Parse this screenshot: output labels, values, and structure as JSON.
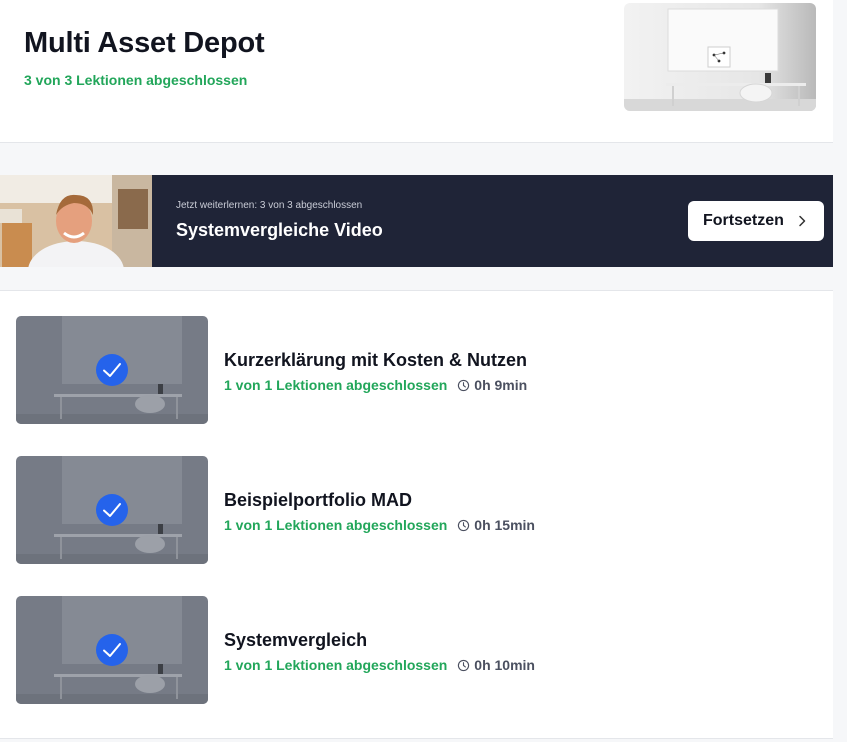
{
  "course": {
    "title": "Multi Asset Depot",
    "progress": "3 von 3 Lektionen abgeschlossen"
  },
  "continue": {
    "subtitle": "Jetzt weiterlernen: 3 von 3 abgeschlossen",
    "title": "Systemvergleiche Video",
    "button_label": "Fortsetzen"
  },
  "lessons": [
    {
      "title": "Kurzerklärung mit Kosten & Nutzen",
      "progress": "1 von 1 Lektionen abgeschlossen",
      "duration": "0h 9min",
      "completed": true
    },
    {
      "title": "Beispielportfolio MAD",
      "progress": "1 von 1 Lektionen abgeschlossen",
      "duration": "0h 15min",
      "completed": true
    },
    {
      "title": "Systemvergleich",
      "progress": "1 von 1 Lektionen abgeschlossen",
      "duration": "0h 10min",
      "completed": true
    }
  ],
  "icons": {
    "check": "check-circle-icon",
    "clock": "clock-icon",
    "chevron": "chevron-right-icon"
  },
  "colors": {
    "accent_green": "#22a65a",
    "banner_bg": "#1f2437",
    "check_blue": "#2563eb"
  }
}
